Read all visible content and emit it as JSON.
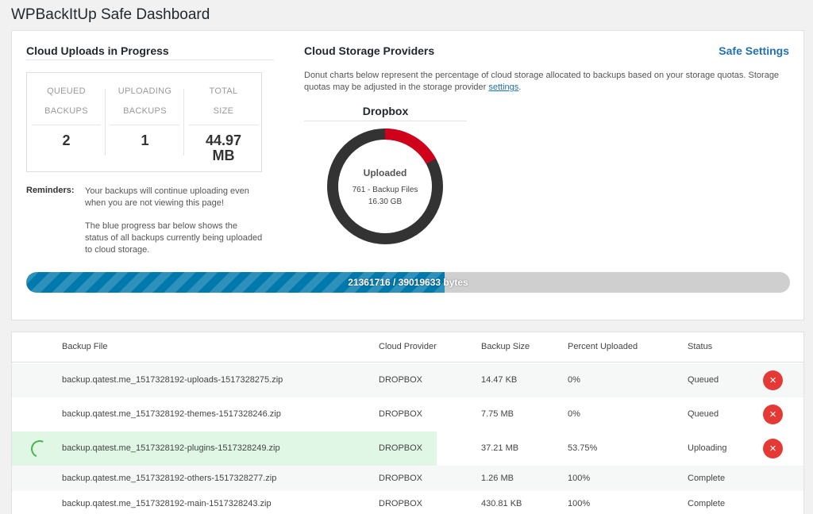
{
  "page_title": "WPBackItUp Safe Dashboard",
  "uploads": {
    "heading": "Cloud Uploads in Progress",
    "stats": [
      {
        "label1": "QUEUED",
        "label2": "BACKUPS",
        "value": "2"
      },
      {
        "label1": "UPLOADING",
        "label2": "BACKUPS",
        "value": "1"
      },
      {
        "label1": "TOTAL",
        "label2": "SIZE",
        "value": "44.97 MB"
      }
    ],
    "reminders_label": "Reminders:",
    "reminder_1": "Your backups will continue uploading even when you are not viewing this page!",
    "reminder_2": "The blue progress bar below shows the status of all backups currently being uploaded to cloud storage."
  },
  "providers": {
    "heading": "Cloud Storage Providers",
    "safe_settings_link": "Safe Settings",
    "description": "Donut charts below represent the percentage of cloud storage allocated to backups based on your storage quotas. Storage quotas may be adjusted in the storage provider",
    "settings_link": "settings",
    "description_end": ".",
    "donut": {
      "provider": "Dropbox",
      "center_title": "Uploaded",
      "files_line": "761 - Backup Files",
      "size_line": "16.30 GB",
      "used_fraction": 0.17,
      "used_color": "#d0021b",
      "remaining_color": "#333333"
    }
  },
  "progress": {
    "uploaded_bytes": 21361716,
    "total_bytes": 39019633,
    "text": "21361716 / 39019633 bytes",
    "fill_color": "#0079ad"
  },
  "table": {
    "headers": {
      "file": "Backup File",
      "provider": "Cloud Provider",
      "size": "Backup Size",
      "percent": "Percent Uploaded",
      "status": "Status"
    },
    "rows": [
      {
        "file": "backup.qatest.me_1517328192-uploads-1517328275.zip",
        "provider": "DROPBOX",
        "size": "14.47 KB",
        "percent": "0%",
        "status": "Queued"
      },
      {
        "file": "backup.qatest.me_1517328192-themes-1517328246.zip",
        "provider": "DROPBOX",
        "size": "7.75 MB",
        "percent": "0%",
        "status": "Queued"
      },
      {
        "file": "backup.qatest.me_1517328192-plugins-1517328249.zip",
        "provider": "DROPBOX",
        "size": "37.21 MB",
        "percent": "53.75%",
        "status": "Uploading"
      },
      {
        "file": "backup.qatest.me_1517328192-others-1517328277.zip",
        "provider": "DROPBOX",
        "size": "1.26 MB",
        "percent": "100%",
        "status": "Complete"
      },
      {
        "file": "backup.qatest.me_1517328192-main-1517328243.zip",
        "provider": "DROPBOX",
        "size": "430.81 KB",
        "percent": "100%",
        "status": "Complete"
      }
    ],
    "cancel_icon": "×"
  }
}
